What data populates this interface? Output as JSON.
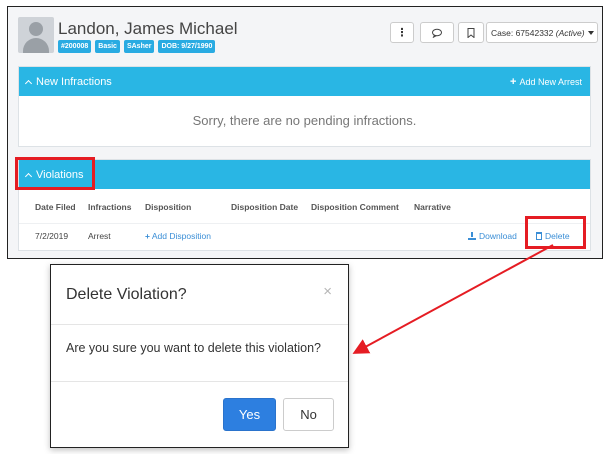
{
  "header": {
    "name": "Landon, James Michael",
    "badges": [
      "#200008",
      "Basic",
      "SAsher",
      "DOB: 9/27/1990"
    ],
    "more_icon": "⋮",
    "comment_icon": "comment-icon",
    "bookmark_icon": "bookmark-icon",
    "case_label": "Case: 67542332",
    "case_status": "(Active)"
  },
  "infractions_panel": {
    "title": "New Infractions",
    "action_label": "Add New Arrest",
    "empty_message": "Sorry, there are no pending infractions."
  },
  "violations_panel": {
    "title": "Violations",
    "columns": [
      "Date Filed",
      "Infractions",
      "Disposition",
      "Disposition Date",
      "Disposition Comment",
      "Narrative"
    ],
    "rows": [
      {
        "date_filed": "7/2/2019",
        "infractions": "Arrest",
        "add_disposition": "Add Disposition",
        "download": "Download",
        "delete": "Delete"
      }
    ]
  },
  "modal": {
    "title": "Delete Violation?",
    "close": "×",
    "message": "Are you sure you want to delete this violation?",
    "yes_label": "Yes",
    "no_label": "No"
  },
  "colors": {
    "panel_header": "#29b6e4",
    "badge": "#29abe2",
    "link": "#3a8ed6",
    "primary_button": "#2d7fe0",
    "highlight_red": "#e51c23"
  }
}
